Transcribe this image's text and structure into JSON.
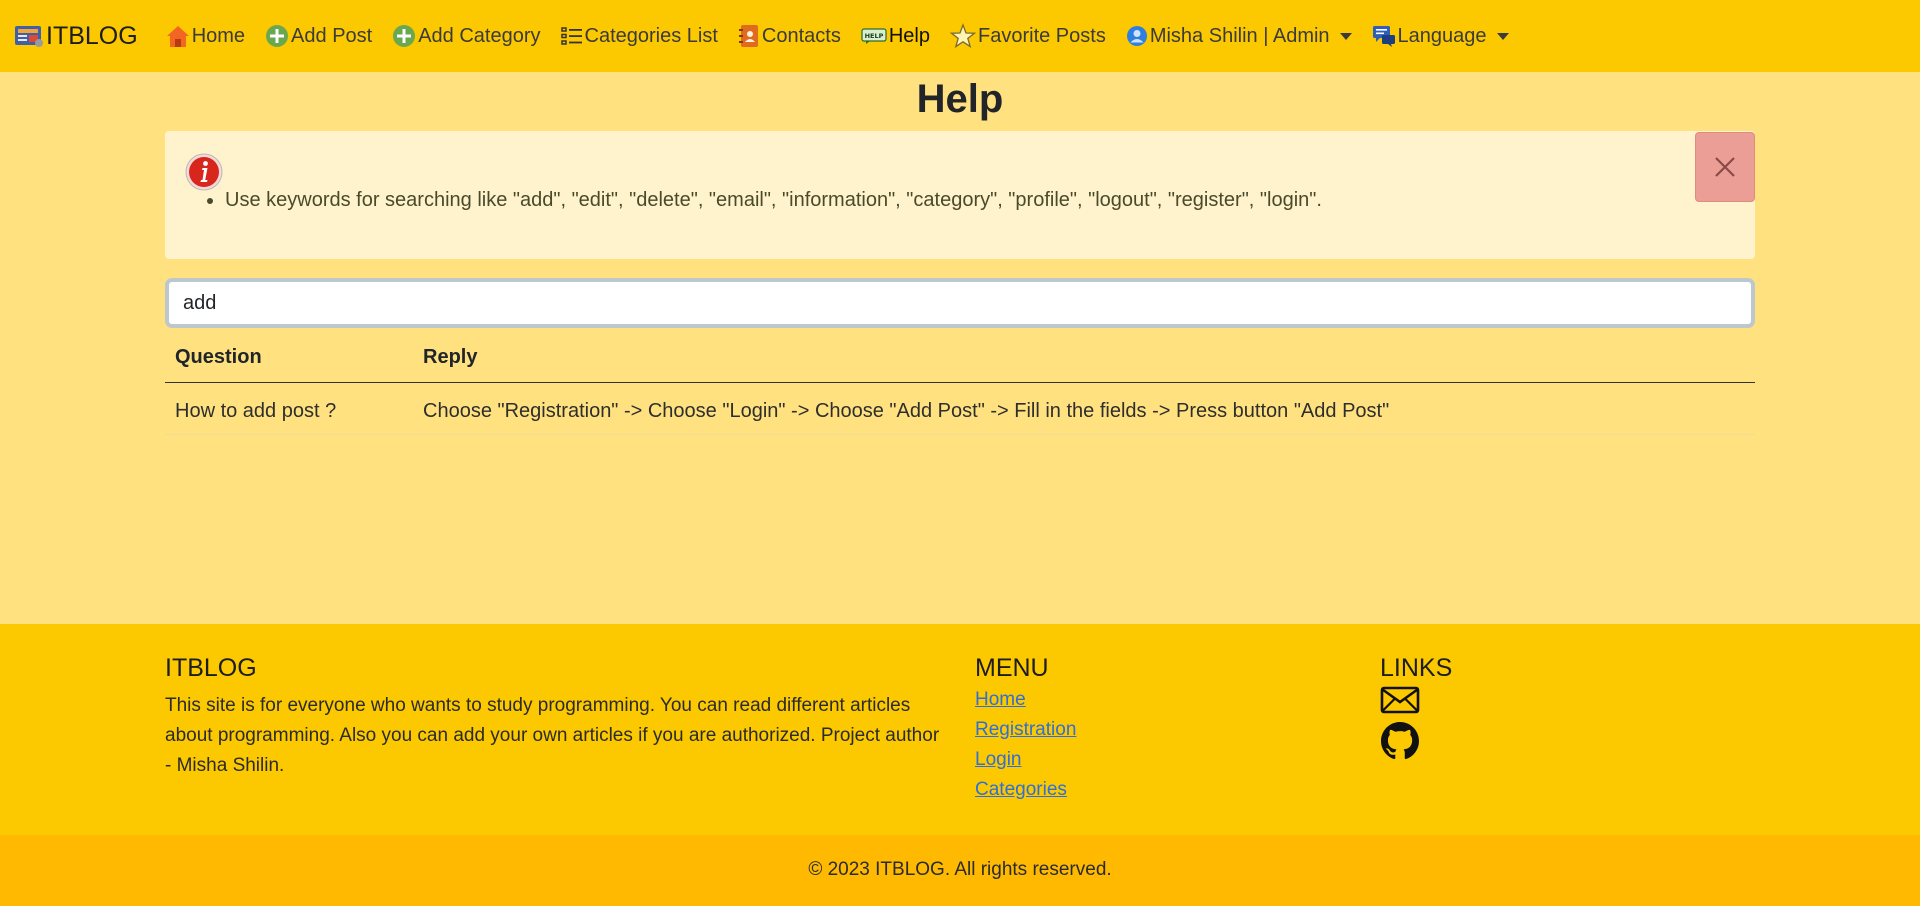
{
  "navbar": {
    "brand": "ITBLOG",
    "items": [
      {
        "label": "Home",
        "icon": "home-icon"
      },
      {
        "label": "Add Post",
        "icon": "plus-circle-icon"
      },
      {
        "label": "Add Category",
        "icon": "plus-circle-icon"
      },
      {
        "label": "Categories List",
        "icon": "list-icon"
      },
      {
        "label": "Contacts",
        "icon": "address-book-icon"
      },
      {
        "label": "Help",
        "icon": "help-badge-icon"
      },
      {
        "label": "Favorite Posts",
        "icon": "star-icon"
      }
    ],
    "user": {
      "label": "Misha Shilin | Admin",
      "icon": "user-icon"
    },
    "language": {
      "label": "Language",
      "icon": "chat-icon"
    },
    "help_badge_text": "HELP"
  },
  "page": {
    "title": "Help",
    "alert": {
      "icon": "info-icon",
      "message": "Use keywords for searching like \"add\", \"edit\", \"delete\", \"email\", \"information\", \"category\", \"profile\", \"logout\", \"register\", \"login\"."
    },
    "search": {
      "value": "add"
    },
    "table": {
      "headers": {
        "question": "Question",
        "reply": "Reply"
      },
      "rows": [
        {
          "question": "How to add post ?",
          "reply": "Choose \"Registration\" -> Choose \"Login\" -> Choose \"Add Post\" -> Fill in the fields -> Press button \"Add Post\""
        }
      ]
    }
  },
  "footer": {
    "about": {
      "title": "ITBLOG",
      "text": "This site is for everyone who wants to study programming. You can read different articles about programming. Also you can add your own articles if you are authorized. Project author - Misha Shilin."
    },
    "menu": {
      "title": "MENU",
      "links": [
        "Home",
        "Registration",
        "Login",
        "Categories"
      ]
    },
    "links": {
      "title": "LINKS",
      "icons": [
        "envelope-icon",
        "github-icon"
      ]
    },
    "copyright": "© 2023 ITBLOG. All rights reserved."
  },
  "colors": {
    "navbar_bg": "#fcc800",
    "page_bg": "#ffe27f",
    "alert_bg": "#fff3cd",
    "close_button_bg": "#eb9e96",
    "copyright_bg": "#ffb900",
    "link": "#2f6fd6"
  }
}
